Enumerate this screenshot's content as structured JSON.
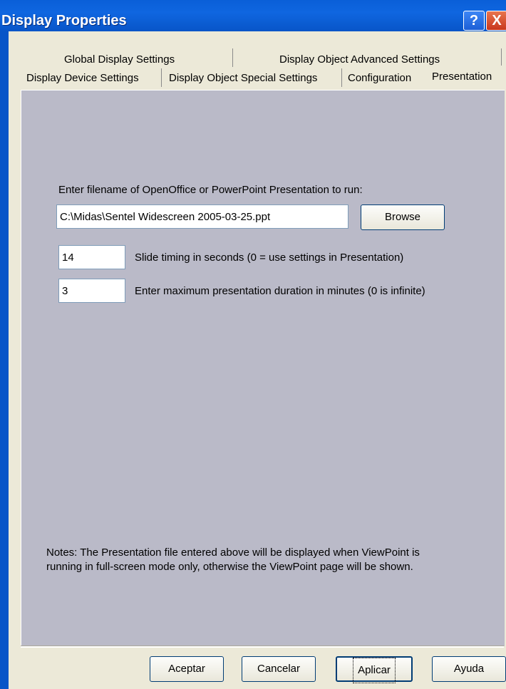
{
  "window": {
    "title": "Display Properties",
    "help_icon": "?",
    "close_icon": "X"
  },
  "tabs": {
    "top_row": [
      "Global Display Settings",
      "Display Object Advanced Settings"
    ],
    "bottom_row": [
      "Display Device Settings",
      "Display Object Special Settings",
      "Configuration",
      "Presentation"
    ],
    "active": "Presentation"
  },
  "presentation": {
    "filename_label": "Enter filename of OpenOffice or PowerPoint Presentation to run:",
    "filename_value": "C:\\Midas\\Sentel Widescreen 2005-03-25.ppt",
    "browse_label": "Browse",
    "slide_timing_value": "14",
    "slide_timing_label": "Slide timing in seconds (0 = use settings in Presentation)",
    "max_duration_value": "3",
    "max_duration_label": "Enter maximum presentation duration in minutes (0 is infinite)",
    "notes_line1": "Notes: The Presentation file entered above will be displayed when ViewPoint  is",
    "notes_line2": "running in full-screen mode only, otherwise the ViewPoint page will be shown."
  },
  "footer": {
    "ok_label": "Aceptar",
    "cancel_label": "Cancelar",
    "apply_label": "Aplicar",
    "help_label": "Ayuda"
  },
  "colors": {
    "titlebar": "#0a5fd8",
    "panel": "#babac8",
    "dialog": "#ece9d8"
  }
}
